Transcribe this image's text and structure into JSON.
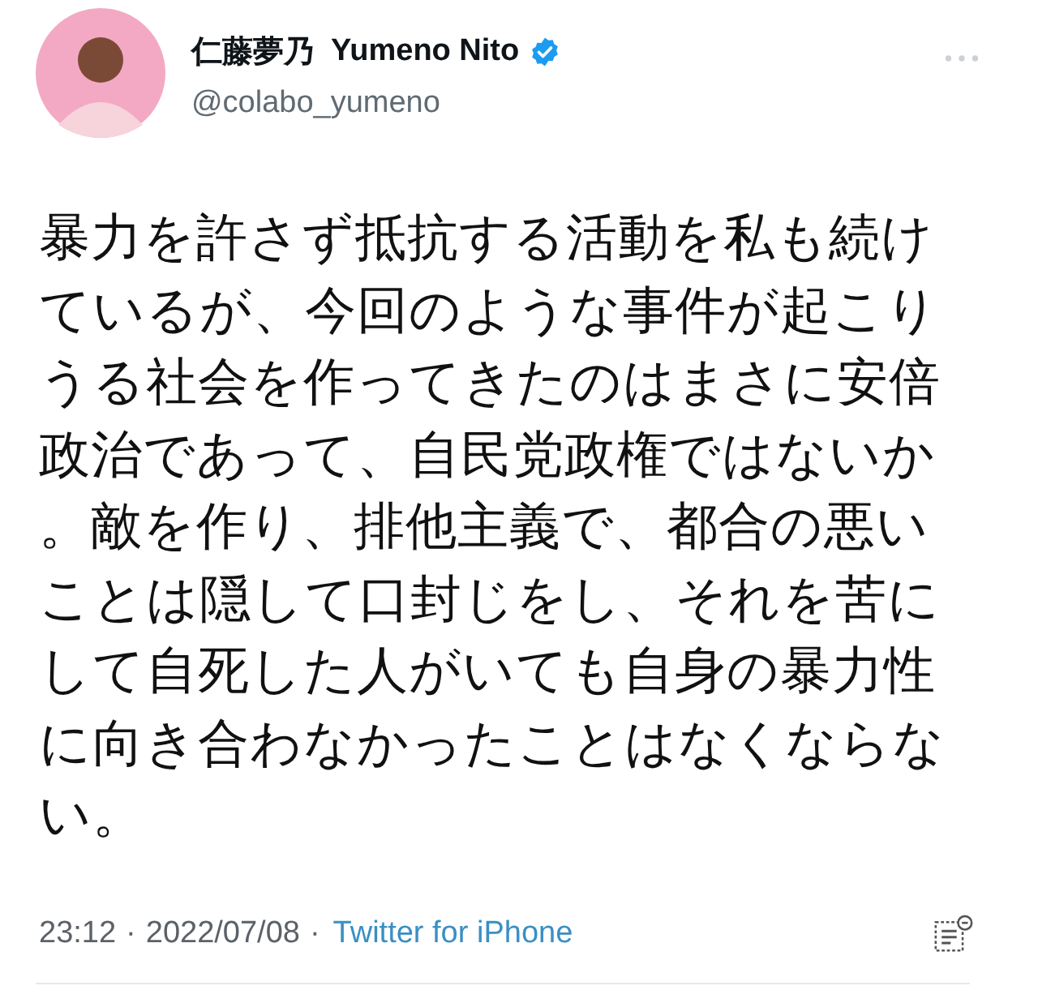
{
  "author": {
    "name_ja": "仁藤夢乃",
    "name_en": "Yumeno Nito",
    "verified": true,
    "handle": "@colabo_yumeno"
  },
  "tweet": {
    "text": "暴力を許さず抵抗する活動を私も続けているが、今回のような事件が起こりうる社会を作ってきたのはまさに安倍政治であって、自民党政権ではないか。敵を作り、排他主義で、都合の悪いことは隠して口封じをし、それを苦にして自死した人がいても自身の暴力性に向き合わなかったことはなくならない。"
  },
  "meta": {
    "time": "23:12",
    "separator_1": "·",
    "date": "2022/07/08",
    "separator_2": "·",
    "source": "Twitter for iPhone"
  }
}
